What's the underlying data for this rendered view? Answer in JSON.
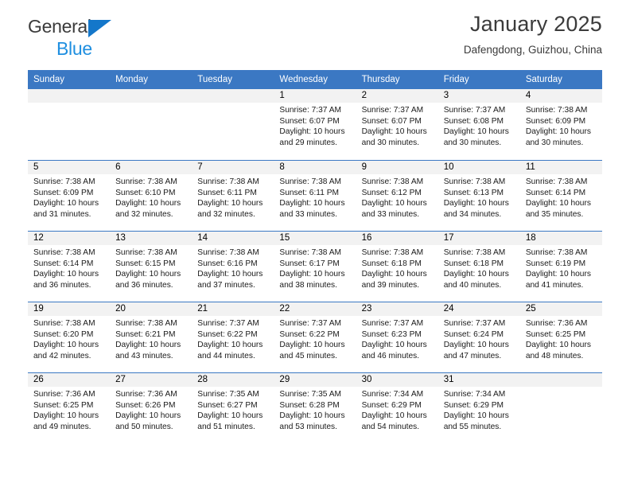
{
  "brand": {
    "name_part1": "General",
    "name_part2": "Blue",
    "triangle_color": "#1477ca",
    "blue_color": "#1f8fe0"
  },
  "header": {
    "title": "January 2025",
    "subtitle": "Dafengdong, Guizhou, China"
  },
  "theme": {
    "header_blue": "#3b78c3",
    "day_number_bg": "#f2f2f2",
    "text_color": "#1a1a1a"
  },
  "weekdays": [
    "Sunday",
    "Monday",
    "Tuesday",
    "Wednesday",
    "Thursday",
    "Friday",
    "Saturday"
  ],
  "labels": {
    "sunrise_prefix": "Sunrise:",
    "sunset_prefix": "Sunset:",
    "daylight_prefix": "Daylight:"
  },
  "weeks": [
    [
      {
        "day": "",
        "empty": true
      },
      {
        "day": "",
        "empty": true
      },
      {
        "day": "",
        "empty": true
      },
      {
        "day": "1",
        "sunrise": "Sunrise: 7:37 AM",
        "sunset": "Sunset: 6:07 PM",
        "daylight": "Daylight: 10 hours and 29 minutes."
      },
      {
        "day": "2",
        "sunrise": "Sunrise: 7:37 AM",
        "sunset": "Sunset: 6:07 PM",
        "daylight": "Daylight: 10 hours and 30 minutes."
      },
      {
        "day": "3",
        "sunrise": "Sunrise: 7:37 AM",
        "sunset": "Sunset: 6:08 PM",
        "daylight": "Daylight: 10 hours and 30 minutes."
      },
      {
        "day": "4",
        "sunrise": "Sunrise: 7:38 AM",
        "sunset": "Sunset: 6:09 PM",
        "daylight": "Daylight: 10 hours and 30 minutes."
      }
    ],
    [
      {
        "day": "5",
        "sunrise": "Sunrise: 7:38 AM",
        "sunset": "Sunset: 6:09 PM",
        "daylight": "Daylight: 10 hours and 31 minutes."
      },
      {
        "day": "6",
        "sunrise": "Sunrise: 7:38 AM",
        "sunset": "Sunset: 6:10 PM",
        "daylight": "Daylight: 10 hours and 32 minutes."
      },
      {
        "day": "7",
        "sunrise": "Sunrise: 7:38 AM",
        "sunset": "Sunset: 6:11 PM",
        "daylight": "Daylight: 10 hours and 32 minutes."
      },
      {
        "day": "8",
        "sunrise": "Sunrise: 7:38 AM",
        "sunset": "Sunset: 6:11 PM",
        "daylight": "Daylight: 10 hours and 33 minutes."
      },
      {
        "day": "9",
        "sunrise": "Sunrise: 7:38 AM",
        "sunset": "Sunset: 6:12 PM",
        "daylight": "Daylight: 10 hours and 33 minutes."
      },
      {
        "day": "10",
        "sunrise": "Sunrise: 7:38 AM",
        "sunset": "Sunset: 6:13 PM",
        "daylight": "Daylight: 10 hours and 34 minutes."
      },
      {
        "day": "11",
        "sunrise": "Sunrise: 7:38 AM",
        "sunset": "Sunset: 6:14 PM",
        "daylight": "Daylight: 10 hours and 35 minutes."
      }
    ],
    [
      {
        "day": "12",
        "sunrise": "Sunrise: 7:38 AM",
        "sunset": "Sunset: 6:14 PM",
        "daylight": "Daylight: 10 hours and 36 minutes."
      },
      {
        "day": "13",
        "sunrise": "Sunrise: 7:38 AM",
        "sunset": "Sunset: 6:15 PM",
        "daylight": "Daylight: 10 hours and 36 minutes."
      },
      {
        "day": "14",
        "sunrise": "Sunrise: 7:38 AM",
        "sunset": "Sunset: 6:16 PM",
        "daylight": "Daylight: 10 hours and 37 minutes."
      },
      {
        "day": "15",
        "sunrise": "Sunrise: 7:38 AM",
        "sunset": "Sunset: 6:17 PM",
        "daylight": "Daylight: 10 hours and 38 minutes."
      },
      {
        "day": "16",
        "sunrise": "Sunrise: 7:38 AM",
        "sunset": "Sunset: 6:18 PM",
        "daylight": "Daylight: 10 hours and 39 minutes."
      },
      {
        "day": "17",
        "sunrise": "Sunrise: 7:38 AM",
        "sunset": "Sunset: 6:18 PM",
        "daylight": "Daylight: 10 hours and 40 minutes."
      },
      {
        "day": "18",
        "sunrise": "Sunrise: 7:38 AM",
        "sunset": "Sunset: 6:19 PM",
        "daylight": "Daylight: 10 hours and 41 minutes."
      }
    ],
    [
      {
        "day": "19",
        "sunrise": "Sunrise: 7:38 AM",
        "sunset": "Sunset: 6:20 PM",
        "daylight": "Daylight: 10 hours and 42 minutes."
      },
      {
        "day": "20",
        "sunrise": "Sunrise: 7:38 AM",
        "sunset": "Sunset: 6:21 PM",
        "daylight": "Daylight: 10 hours and 43 minutes."
      },
      {
        "day": "21",
        "sunrise": "Sunrise: 7:37 AM",
        "sunset": "Sunset: 6:22 PM",
        "daylight": "Daylight: 10 hours and 44 minutes."
      },
      {
        "day": "22",
        "sunrise": "Sunrise: 7:37 AM",
        "sunset": "Sunset: 6:22 PM",
        "daylight": "Daylight: 10 hours and 45 minutes."
      },
      {
        "day": "23",
        "sunrise": "Sunrise: 7:37 AM",
        "sunset": "Sunset: 6:23 PM",
        "daylight": "Daylight: 10 hours and 46 minutes."
      },
      {
        "day": "24",
        "sunrise": "Sunrise: 7:37 AM",
        "sunset": "Sunset: 6:24 PM",
        "daylight": "Daylight: 10 hours and 47 minutes."
      },
      {
        "day": "25",
        "sunrise": "Sunrise: 7:36 AM",
        "sunset": "Sunset: 6:25 PM",
        "daylight": "Daylight: 10 hours and 48 minutes."
      }
    ],
    [
      {
        "day": "26",
        "sunrise": "Sunrise: 7:36 AM",
        "sunset": "Sunset: 6:25 PM",
        "daylight": "Daylight: 10 hours and 49 minutes."
      },
      {
        "day": "27",
        "sunrise": "Sunrise: 7:36 AM",
        "sunset": "Sunset: 6:26 PM",
        "daylight": "Daylight: 10 hours and 50 minutes."
      },
      {
        "day": "28",
        "sunrise": "Sunrise: 7:35 AM",
        "sunset": "Sunset: 6:27 PM",
        "daylight": "Daylight: 10 hours and 51 minutes."
      },
      {
        "day": "29",
        "sunrise": "Sunrise: 7:35 AM",
        "sunset": "Sunset: 6:28 PM",
        "daylight": "Daylight: 10 hours and 53 minutes."
      },
      {
        "day": "30",
        "sunrise": "Sunrise: 7:34 AM",
        "sunset": "Sunset: 6:29 PM",
        "daylight": "Daylight: 10 hours and 54 minutes."
      },
      {
        "day": "31",
        "sunrise": "Sunrise: 7:34 AM",
        "sunset": "Sunset: 6:29 PM",
        "daylight": "Daylight: 10 hours and 55 minutes."
      },
      {
        "day": "",
        "empty": true
      }
    ]
  ]
}
